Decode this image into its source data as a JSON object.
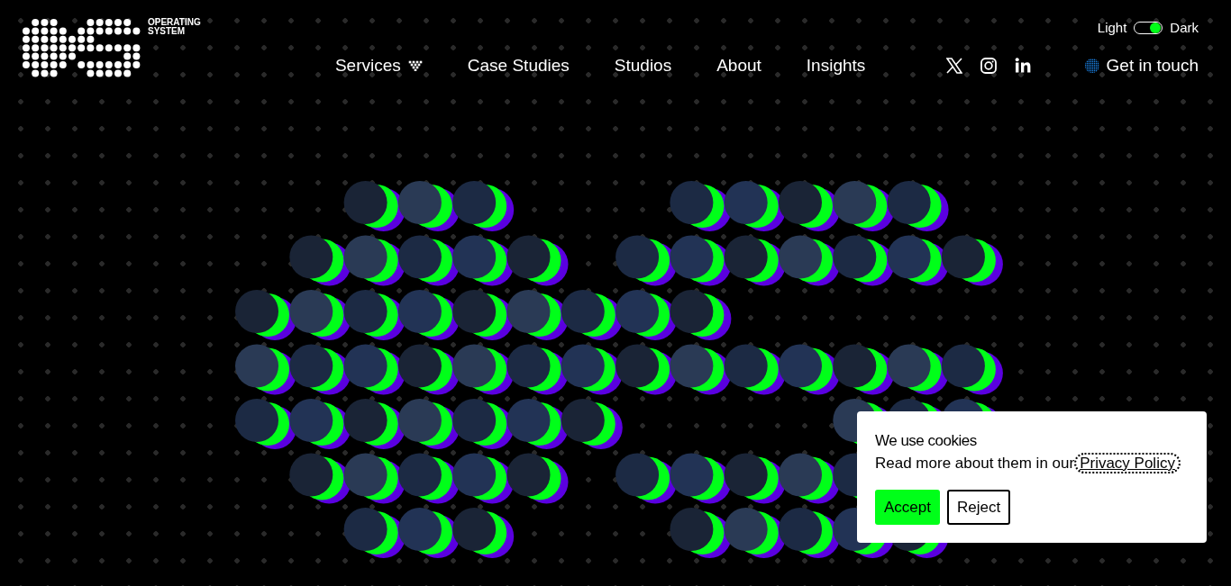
{
  "logo": {
    "text_lines": [
      "OPERATING",
      "SYSTEM"
    ]
  },
  "theme_toggle": {
    "left_label": "Light",
    "right_label": "Dark",
    "on": true
  },
  "nav": [
    {
      "label": "Services",
      "has_menu": true
    },
    {
      "label": "Case Studies",
      "has_menu": false
    },
    {
      "label": "Studios",
      "has_menu": false
    },
    {
      "label": "About",
      "has_menu": false
    },
    {
      "label": "Insights",
      "has_menu": false
    }
  ],
  "social": [
    {
      "kind": "x"
    },
    {
      "kind": "instagram"
    },
    {
      "kind": "linkedin"
    }
  ],
  "contact": {
    "label": "Get in touch"
  },
  "cookie_banner": {
    "title": "We use cookies",
    "text": "Read more about them in our",
    "link": "Privacy Policy",
    "buttons": [
      {
        "label": "Accept",
        "kind": "primary"
      },
      {
        "label": "Reject",
        "kind": "outline"
      }
    ]
  }
}
